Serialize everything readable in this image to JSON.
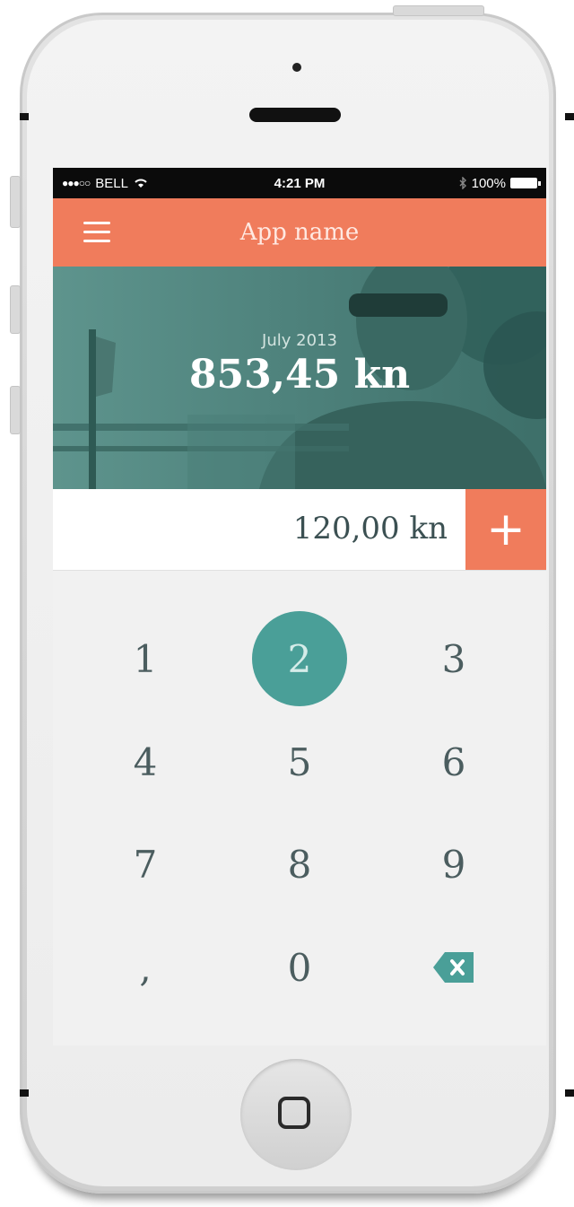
{
  "status_bar": {
    "carrier": "BELL",
    "time": "4:21 PM",
    "battery": "100%"
  },
  "navbar": {
    "title": "App name"
  },
  "hero": {
    "period": "July 2013",
    "total": "853,45 kn"
  },
  "entry": {
    "value": "120,00 kn",
    "add_label": "+"
  },
  "keypad": {
    "keys": [
      "1",
      "2",
      "3",
      "4",
      "5",
      "6",
      "7",
      "8",
      "9",
      ",",
      "0"
    ],
    "active_key": "2",
    "delete_icon": "backspace-icon"
  },
  "colors": {
    "accent": "#f07c5c",
    "teal": "#4a9f98",
    "hero": "#4f837d"
  }
}
